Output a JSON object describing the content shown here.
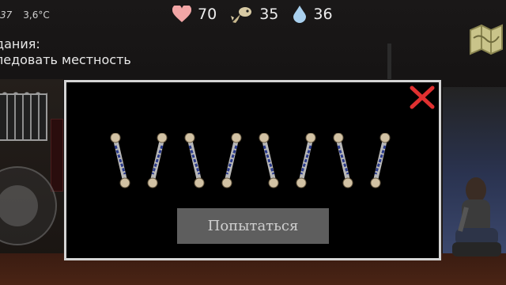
{
  "hud": {
    "time": "37",
    "temperature": "3,6°C"
  },
  "stats": {
    "health": {
      "icon": "heart-icon",
      "value": "70",
      "color": "#f2a6a6"
    },
    "food": {
      "icon": "fish-icon",
      "value": "35",
      "color": "#d8caa4"
    },
    "water": {
      "icon": "water-drop-icon",
      "value": "36",
      "color": "#a9d0ee"
    }
  },
  "quest": {
    "title": "дания:",
    "task": "ледовать местность"
  },
  "map_button": {
    "icon": "map-icon"
  },
  "modal": {
    "close_icon": "close-icon",
    "accent": "#e03030",
    "lockpick_count": 8,
    "try_label": "Попытаться"
  }
}
